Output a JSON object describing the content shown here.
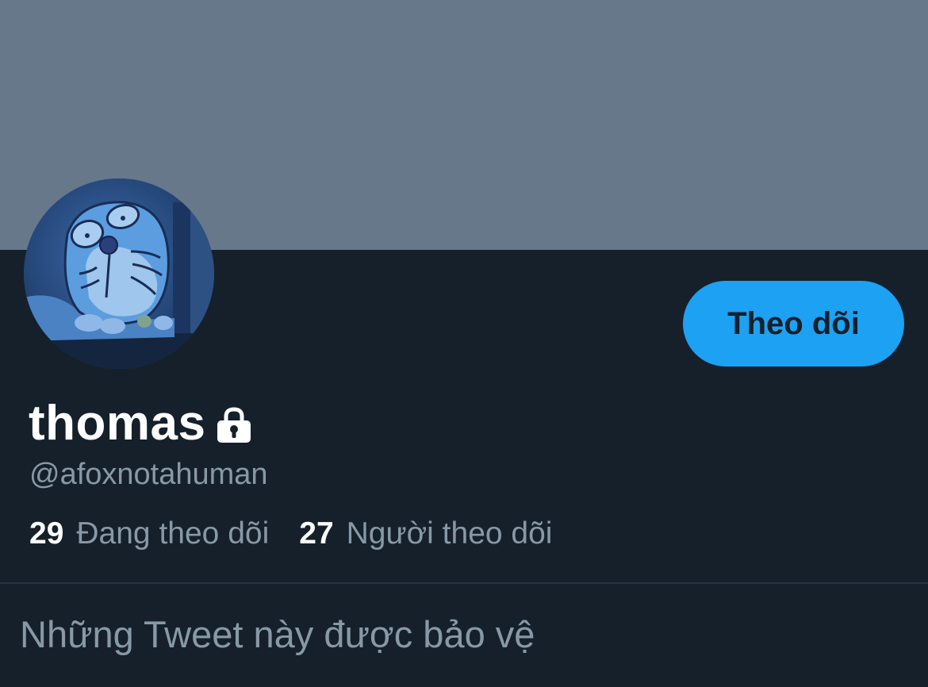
{
  "profile": {
    "display_name": "thomas",
    "handle": "@afoxnotahuman",
    "protected": true,
    "lock_icon": "lock-icon",
    "avatar_description": "avatar",
    "follow_button_label": "Theo dõi",
    "following": {
      "count": "29",
      "label": "Đang theo dõi"
    },
    "followers": {
      "count": "27",
      "label": "Người theo dõi"
    },
    "protected_notice": "Những Tweet này được bảo vệ"
  },
  "colors": {
    "background": "#15202b",
    "banner": "#66788a",
    "accent": "#1da1f2",
    "primary_text": "#ffffff",
    "secondary_text": "#8899a6"
  }
}
